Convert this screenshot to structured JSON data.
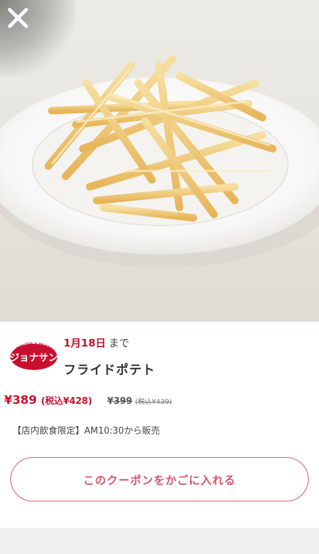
{
  "header": {
    "close_label": "close"
  },
  "coupon": {
    "expiry_date": "1月18日",
    "expiry_suffix": "まで",
    "product_name": "フライドポテト",
    "price": "¥389",
    "price_with_tax": "(税込¥428)",
    "original_price": "¥399",
    "original_price_with_tax": "(税込¥439)",
    "note": "【店内飲食限定】AM10:30から販売",
    "add_to_cart_label": "このクーポンをかごに入れる"
  },
  "brand": {
    "logo_small_text": "COFFEE & RESTAURANT",
    "logo_name": "ジョナサン"
  },
  "colors": {
    "accent": "#c8102e",
    "button_outline": "#d9546a",
    "footer": "#efefef"
  }
}
